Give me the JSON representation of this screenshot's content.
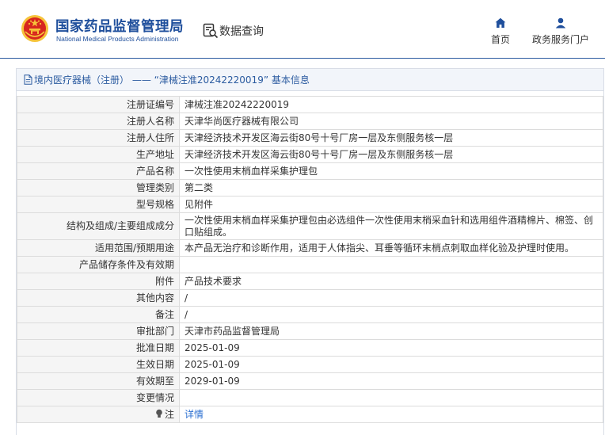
{
  "header": {
    "agency_cn": "国家药品监督管理局",
    "agency_en": "National Medical Products Administration",
    "query_label": "数据查询",
    "nav": {
      "home": "首页",
      "portal": "政务服务门户"
    }
  },
  "detail": {
    "title": "境内医疗器械（注册） —— “津械注准20242220019” 基本信息",
    "rows": [
      {
        "label": "注册证编号",
        "value": "津械注准20242220019"
      },
      {
        "label": "注册人名称",
        "value": "天津华尚医疗器械有限公司"
      },
      {
        "label": "注册人住所",
        "value": "天津经济技术开发区海云街80号十号厂房一层及东侧服务核一层"
      },
      {
        "label": "生产地址",
        "value": "天津经济技术开发区海云街80号十号厂房一层及东侧服务核一层"
      },
      {
        "label": "产品名称",
        "value": "一次性使用末梢血样采集护理包"
      },
      {
        "label": "管理类别",
        "value": "第二类"
      },
      {
        "label": "型号规格",
        "value": "见附件"
      },
      {
        "label": "结构及组成/主要组成成分",
        "value": "一次性使用末梢血样采集护理包由必选组件一次性使用末梢采血针和选用组件酒精棉片、棉签、创口贴组成。"
      },
      {
        "label": "适用范围/预期用途",
        "value": "本产品无治疗和诊断作用，适用于人体指尖、耳垂等循环末梢点刺取血样化验及护理时使用。"
      },
      {
        "label": "产品储存条件及有效期",
        "value": ""
      },
      {
        "label": "附件",
        "value": "产品技术要求"
      },
      {
        "label": "其他内容",
        "value": "/"
      },
      {
        "label": "备注",
        "value": "/"
      },
      {
        "label": "审批部门",
        "value": "天津市药品监督管理局"
      },
      {
        "label": "批准日期",
        "value": "2025-01-09"
      },
      {
        "label": "生效日期",
        "value": "2025-01-09"
      },
      {
        "label": "有效期至",
        "value": "2029-01-09"
      },
      {
        "label": "变更情况",
        "value": ""
      }
    ],
    "note_label": "注",
    "note_link": "详情"
  },
  "colors": {
    "brand_blue": "#1f4f9c",
    "link_blue": "#2b6fd1",
    "label_bg": "#f5f5f5",
    "emblem_red": "#d7261e",
    "emblem_gold": "#f6c33a"
  }
}
